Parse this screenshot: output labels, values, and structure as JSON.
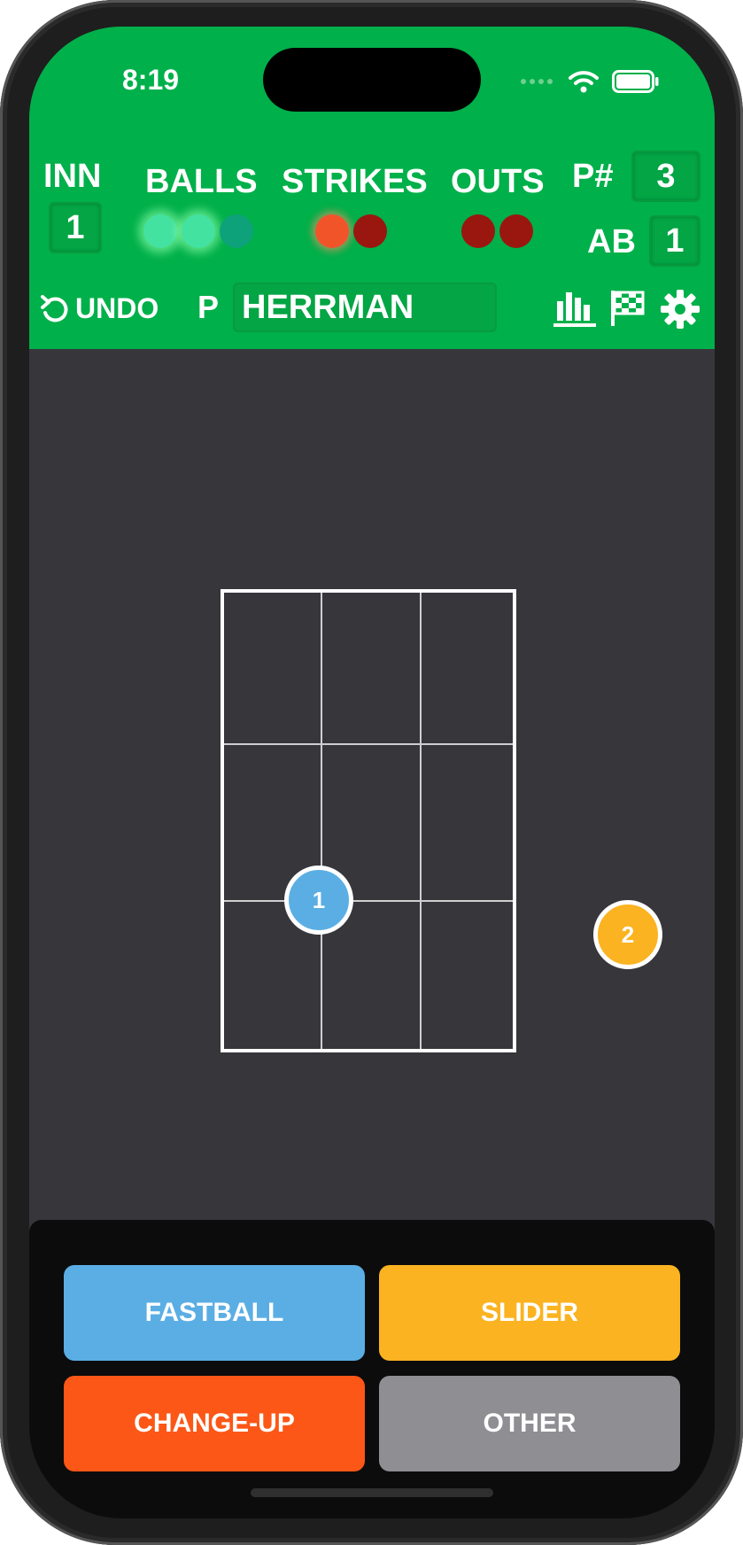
{
  "status": {
    "time": "8:19"
  },
  "scoreboard": {
    "inning_label": "INN",
    "inning": "1",
    "balls_label": "BALLS",
    "balls": 2,
    "strikes_label": "STRIKES",
    "strikes": 1,
    "outs_label": "OUTS",
    "outs": 2,
    "pitch_count_label": "P#",
    "pitch_count": "3",
    "at_bat_label": "AB",
    "at_bat": "1"
  },
  "toolbar": {
    "undo_label": "UNDO",
    "pitcher_label": "P",
    "pitcher_name": "HERRMAN"
  },
  "pitches": [
    {
      "number": "1",
      "type": "FASTBALL"
    },
    {
      "number": "2",
      "type": "SLIDER"
    }
  ],
  "pitch_types": [
    {
      "label": "FASTBALL",
      "color": "#5baee4"
    },
    {
      "label": "SLIDER",
      "color": "#fbb321"
    },
    {
      "label": "CHANGE-UP",
      "color": "#fc5716"
    },
    {
      "label": "OTHER",
      "color": "#8e8e93"
    }
  ],
  "colors": {
    "header": "#00b04a",
    "field": "#37363b"
  },
  "icons": [
    "wifi-icon",
    "battery-icon",
    "undo-icon",
    "stats-chart-icon",
    "checkered-flag-icon",
    "gear-icon"
  ]
}
